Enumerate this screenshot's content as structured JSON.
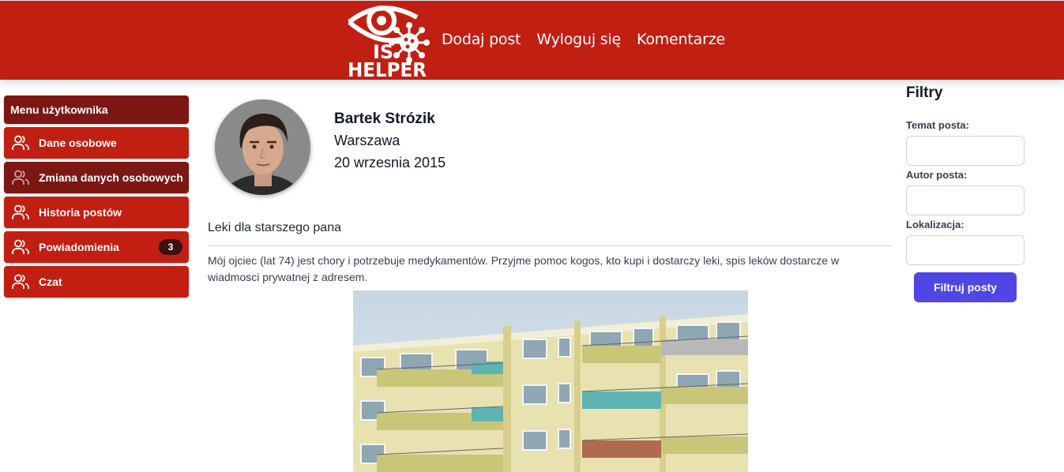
{
  "header": {
    "logo": {
      "text_top": "IS",
      "text_bottom": "HELPER",
      "icon": "eye-virus-logo"
    },
    "nav": [
      "Dodaj post",
      "Wyloguj się",
      "Komentarze"
    ],
    "bg_color": "#c11f12"
  },
  "sidebar": {
    "title": "Menu użytkownika",
    "items": [
      {
        "label": "Dane osobowe",
        "icon": "users-icon"
      },
      {
        "label": "Zmiana danych osobowych",
        "icon": "users-icon",
        "active": true
      },
      {
        "label": "Historia postów",
        "icon": "users-icon"
      },
      {
        "label": "Powiadomienia",
        "icon": "users-icon",
        "badge": "3"
      },
      {
        "label": "Czat",
        "icon": "users-icon"
      }
    ]
  },
  "profile": {
    "name": "Bartek Strózik",
    "city": "Warszawa",
    "date": "20 wrzesnia 2015"
  },
  "post": {
    "title": "Leki dla starszego pana",
    "body": "Mój ojciec (lat 74) jest chory i potrzebuje medykamentów. Przyjme pomoc kogos, kto kupi i dostarczy leki, spis leków dostarcze w wiadmosci prywatnej z adresem."
  },
  "filters": {
    "title": "Filtry",
    "topic_label": "Temat posta:",
    "author_label": "Autor posta:",
    "location_label": "Lokalizacja:",
    "topic_value": "",
    "author_value": "",
    "location_value": "",
    "button_label": "Filtruj posty",
    "button_color": "#4f46e5"
  }
}
